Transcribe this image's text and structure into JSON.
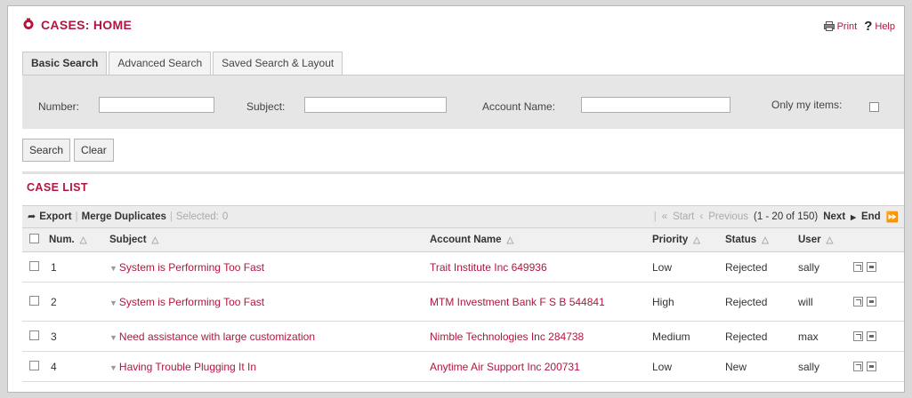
{
  "header": {
    "title": "CASES: HOME",
    "print_label": "Print",
    "help_label": "Help"
  },
  "tabs": [
    {
      "label": "Basic Search",
      "active": true
    },
    {
      "label": "Advanced Search",
      "active": false
    },
    {
      "label": "Saved Search & Layout",
      "active": false
    }
  ],
  "search": {
    "number_label": "Number:",
    "number_value": "",
    "subject_label": "Subject:",
    "subject_value": "",
    "account_label": "Account Name:",
    "account_value": "",
    "only_my_items_label": "Only my items:",
    "only_my_items_checked": false
  },
  "buttons": {
    "search": "Search",
    "clear": "Clear"
  },
  "case_list": {
    "title": "CASE LIST",
    "toolbar": {
      "export": "Export",
      "merge": "Merge Duplicates",
      "selected_label": "Selected:",
      "selected_count": "0",
      "start": "Start",
      "previous": "Previous",
      "range": "(1 - 20 of 150)",
      "next": "Next",
      "end": "End"
    },
    "columns": [
      "Num.",
      "Subject",
      "Account Name",
      "Priority",
      "Status",
      "User"
    ],
    "rows": [
      {
        "num": "1",
        "subject": "System is Performing Too Fast",
        "account": "Trait Institute Inc 649936",
        "priority": "Low",
        "status": "Rejected",
        "user": "sally"
      },
      {
        "num": "2",
        "subject": "System is Performing Too Fast",
        "account": "MTM Investment Bank F S B 544841",
        "priority": "High",
        "status": "Rejected",
        "user": "will"
      },
      {
        "num": "3",
        "subject": "Need assistance with large customization",
        "account": "Nimble Technologies Inc 284738",
        "priority": "Medium",
        "status": "Rejected",
        "user": "max"
      },
      {
        "num": "4",
        "subject": "Having Trouble Plugging It In",
        "account": "Anytime Air Support Inc 200731",
        "priority": "Low",
        "status": "New",
        "user": "sally"
      }
    ]
  },
  "colors": {
    "accent": "#b0163f",
    "panel": "#e6e6e6"
  }
}
